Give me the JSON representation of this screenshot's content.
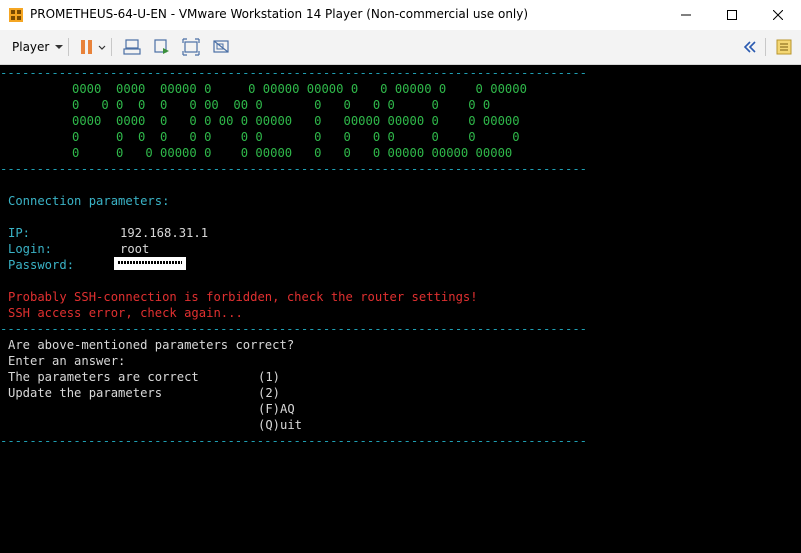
{
  "window": {
    "title": "PROMETHEUS-64-U-EN - VMware Workstation 14 Player (Non-commercial use only)",
    "minimize": "—",
    "maximize": "☐",
    "close": "✕"
  },
  "toolbar": {
    "player_label": "Player"
  },
  "terminal": {
    "rule": "--------------------------------------------------------------------------------",
    "banner": [
      "0000  0000  00000 0     0 00000 00000 0   0 00000 0    0 00000",
      "0   0 0  0  0   0 00  00 0       0   0   0 0     0    0 0",
      "0000  0000  0   0 0 00 0 00000   0   00000 00000 0    0 00000",
      "0     0  0  0   0 0    0 0       0   0   0 0     0    0     0",
      "0     0   0 00000 0    0 00000   0   0   0 00000 00000 00000"
    ],
    "conn_header": "Connection parameters:",
    "ip_label": "IP:",
    "ip_value": "192.168.31.1",
    "login_label": "Login:",
    "login_value": "root",
    "password_label": "Password:",
    "error1": "Probably SSH-connection is forbidden, check the router settings!",
    "error2": "SSH access error, check again...",
    "question": "Are above-mentioned parameters correct?",
    "prompt": "Enter an answer:",
    "options": [
      {
        "text": "The parameters are correct",
        "key": "(1)"
      },
      {
        "text": "Update the parameters",
        "key": "(2)"
      },
      {
        "text": "",
        "key": "(F)AQ"
      },
      {
        "text": "",
        "key": "(Q)uit"
      }
    ]
  }
}
